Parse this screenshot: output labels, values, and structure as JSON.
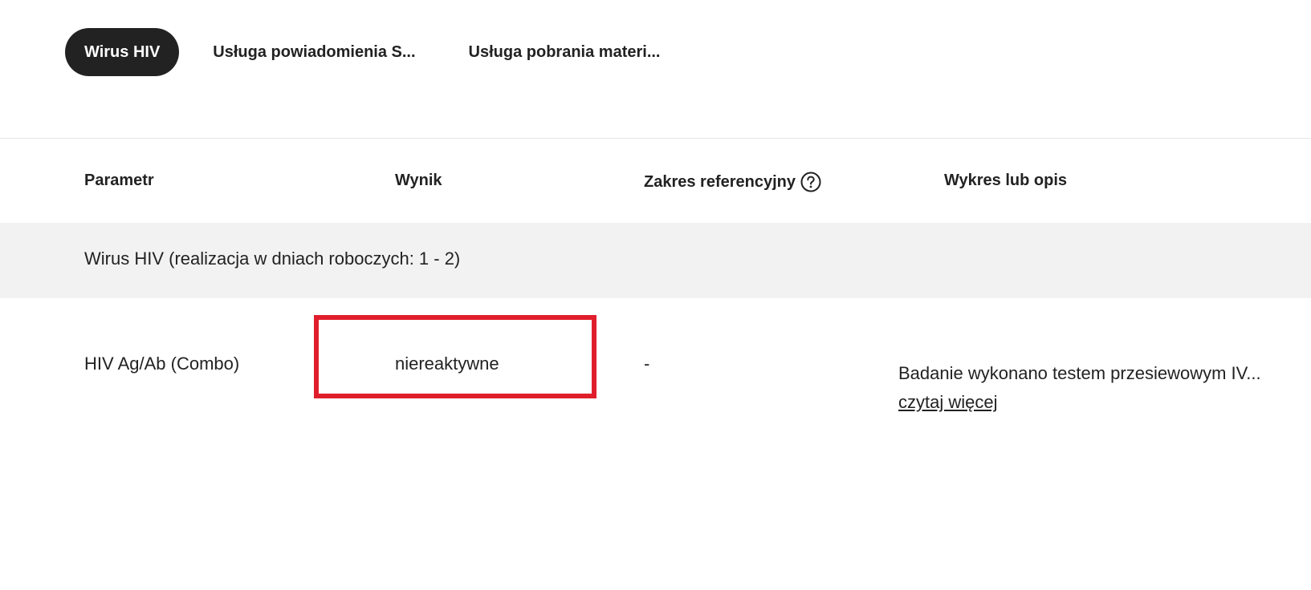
{
  "tabs": [
    {
      "label": "Wirus HIV",
      "active": true
    },
    {
      "label": "Usługa powiadomienia S...",
      "active": false
    },
    {
      "label": "Usługa pobrania materi...",
      "active": false
    }
  ],
  "table": {
    "headers": {
      "parameter": "Parametr",
      "result": "Wynik",
      "reference_range": "Zakres referencyjny",
      "chart_or_description": "Wykres lub opis"
    },
    "group": {
      "label": "Wirus HIV (realizacja w dniach roboczych: 1 - 2)"
    },
    "rows": [
      {
        "parameter": "HIV Ag/Ab (Combo)",
        "result": "niereaktywne",
        "reference_range": "-",
        "description": "Badanie wykonano testem przesiewowym IV...",
        "read_more": "czytaj więcej"
      }
    ]
  },
  "colors": {
    "active_tab_bg": "#222222",
    "highlight_border": "#e01e2b",
    "group_row_bg": "#f2f2f2"
  },
  "icons": {
    "reference_help": "help-circle-icon"
  }
}
